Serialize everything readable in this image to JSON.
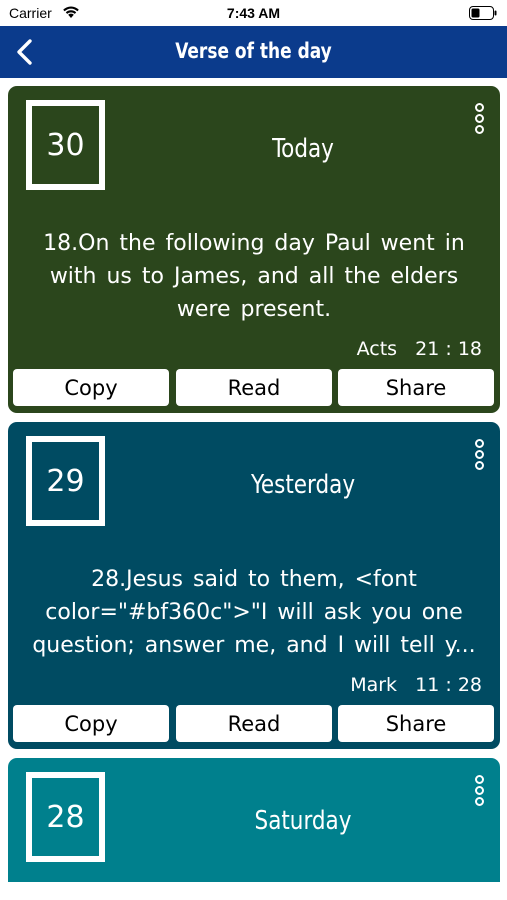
{
  "status": {
    "carrier": "Carrier",
    "time": "7:43 AM"
  },
  "nav": {
    "title": "Verse of the day",
    "back_icon": "chevron-left-icon"
  },
  "cards": [
    {
      "day_number": "30",
      "label": "Today",
      "verse": "18.On the following day Paul went in with us to James, and all the elders were present.",
      "reference": "Acts   21 : 18",
      "color": "#2b461c"
    },
    {
      "day_number": "29",
      "label": "Yesterday",
      "verse": "28.Jesus said to them, <font color=\"#bf360c\">\"I will ask you one question; answer me, and I will tell y...",
      "reference": "Mark   11 : 28",
      "color": "#004b62"
    },
    {
      "day_number": "28",
      "label": "Saturday",
      "color": "#00808d"
    }
  ],
  "buttons": {
    "copy": "Copy",
    "read": "Read",
    "share": "Share"
  },
  "colors": {
    "nav_bar": "#0b3b8c"
  }
}
